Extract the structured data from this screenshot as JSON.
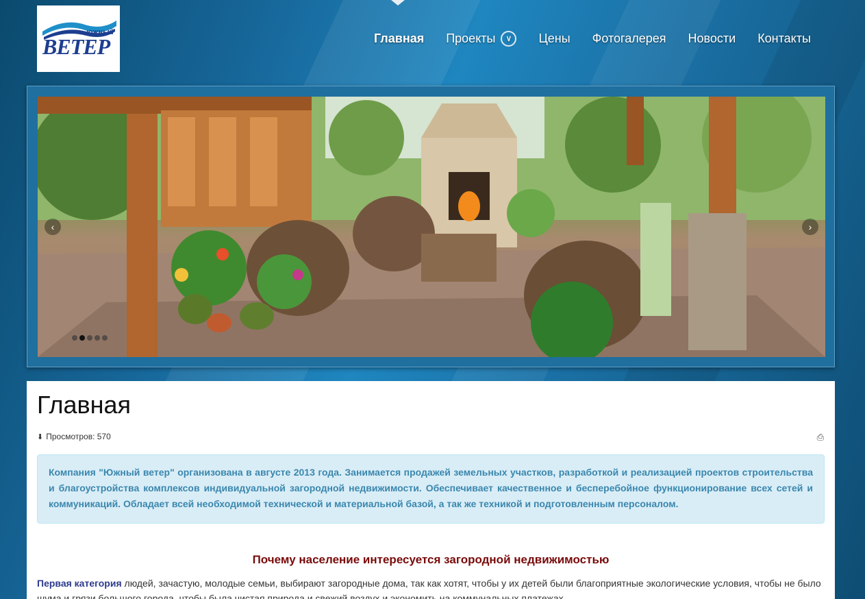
{
  "logo": {
    "small_text": "южный",
    "big_text": "ВЕТЕР"
  },
  "nav": {
    "items": [
      {
        "label": "Главная",
        "active": true
      },
      {
        "label": "Проекты",
        "active": false,
        "has_dropdown": true
      },
      {
        "label": "Цены",
        "active": false
      },
      {
        "label": "Фотогалерея",
        "active": false
      },
      {
        "label": "Новости",
        "active": false
      },
      {
        "label": "Контакты",
        "active": false
      }
    ]
  },
  "slider": {
    "arrow_left": "‹",
    "arrow_right": "›",
    "dots_count": 5,
    "active_dot": 1
  },
  "page": {
    "title": "Главная",
    "views_label": "Просмотров:",
    "views_count": "570",
    "info_text": "Компания \"Южный ветер\" организована в августе 2013 года. Занимается продажей земельных участков, разработкой и реализацией проектов строительства и благоустройства комплексов индивидуальной загородной недвижимости. Обеспечивает качественное и бесперебойное функционирование всех сетей и коммуникаций. Обладает всей необходимой технической и материальной базой, а так же техникой и подготовленным персоналом.",
    "section_heading": "Почему население интересуется загородной недвижимостью",
    "paragraph_lead": "Первая категория",
    "paragraph_text": " людей, зачастую, молодые семьи, выбирают загородные дома, так как хотят, чтобы у их детей были благоприятные экологические условия, чтобы не было шума и грязи большого города, чтобы была чистая природа и свежий воздух и экономить на коммунальных платежах."
  },
  "colors": {
    "info_bg": "#d9edf7",
    "info_text": "#3a87ad",
    "heading": "#7a0a0a",
    "lead": "#2e3a8c"
  }
}
